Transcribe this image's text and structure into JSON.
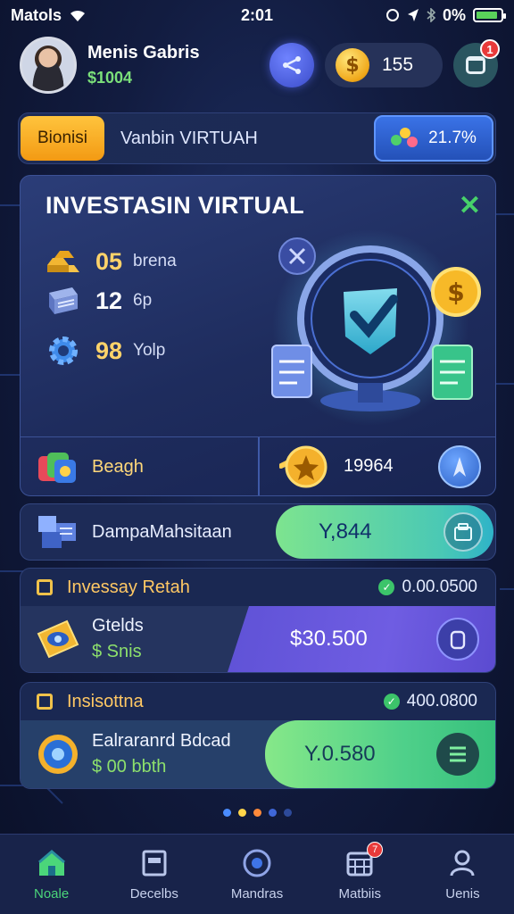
{
  "status_bar": {
    "carrier": "Matols",
    "time": "2:01",
    "battery": "0%"
  },
  "header": {
    "user_name": "Menis Gabris",
    "balance": "$1004",
    "coin_count": "155",
    "notification_count": "1",
    "coin_symbol": "$"
  },
  "tab_row": {
    "active_tab": "Bionisi",
    "title": "Vanbin VIRTUAH",
    "percent": "21.7%"
  },
  "card": {
    "title": "INVESTASIN VIRTUAL",
    "stats": [
      {
        "value": "05",
        "label": "brena",
        "icon": "gold-bars-icon"
      },
      {
        "value": "12",
        "label": "6p",
        "icon": "book-icon"
      },
      {
        "value": "98",
        "label": "Yolp",
        "icon": "gear-icon"
      }
    ],
    "bottom_left_label": "Beagh",
    "bottom_right_value": "19964"
  },
  "row_dm": {
    "label": "DampaMahsitaan",
    "value": "Y,844"
  },
  "section1": {
    "title": "Invessay Retah",
    "status_value": "0.00.0500",
    "item_name": "Gtelds",
    "item_sub": "$ Snis",
    "pill_value": "$30.500"
  },
  "section2": {
    "title": "Insisottna",
    "status_value": "400.0800",
    "item_name": "Ealraranrd Bdcad",
    "item_sub": "$ 00 bbth",
    "pill_value": "Y.0.580"
  },
  "page_dots": {
    "count": 5,
    "active": 1
  },
  "bottom_nav": [
    {
      "label": "Noale",
      "icon": "home-icon",
      "active": true
    },
    {
      "label": "Decelbs",
      "icon": "document-icon",
      "active": false
    },
    {
      "label": "Mandras",
      "icon": "target-icon",
      "active": false
    },
    {
      "label": "Matbiis",
      "icon": "calendar-icon",
      "active": false,
      "badge": "7"
    },
    {
      "label": "Uenis",
      "icon": "user-icon",
      "active": false
    }
  ],
  "colors": {
    "accent_green": "#4bd67a",
    "accent_yellow": "#ffc43d",
    "accent_blue": "#3a72e6",
    "badge_red": "#e83a3a",
    "purple": "#6f5de2"
  }
}
